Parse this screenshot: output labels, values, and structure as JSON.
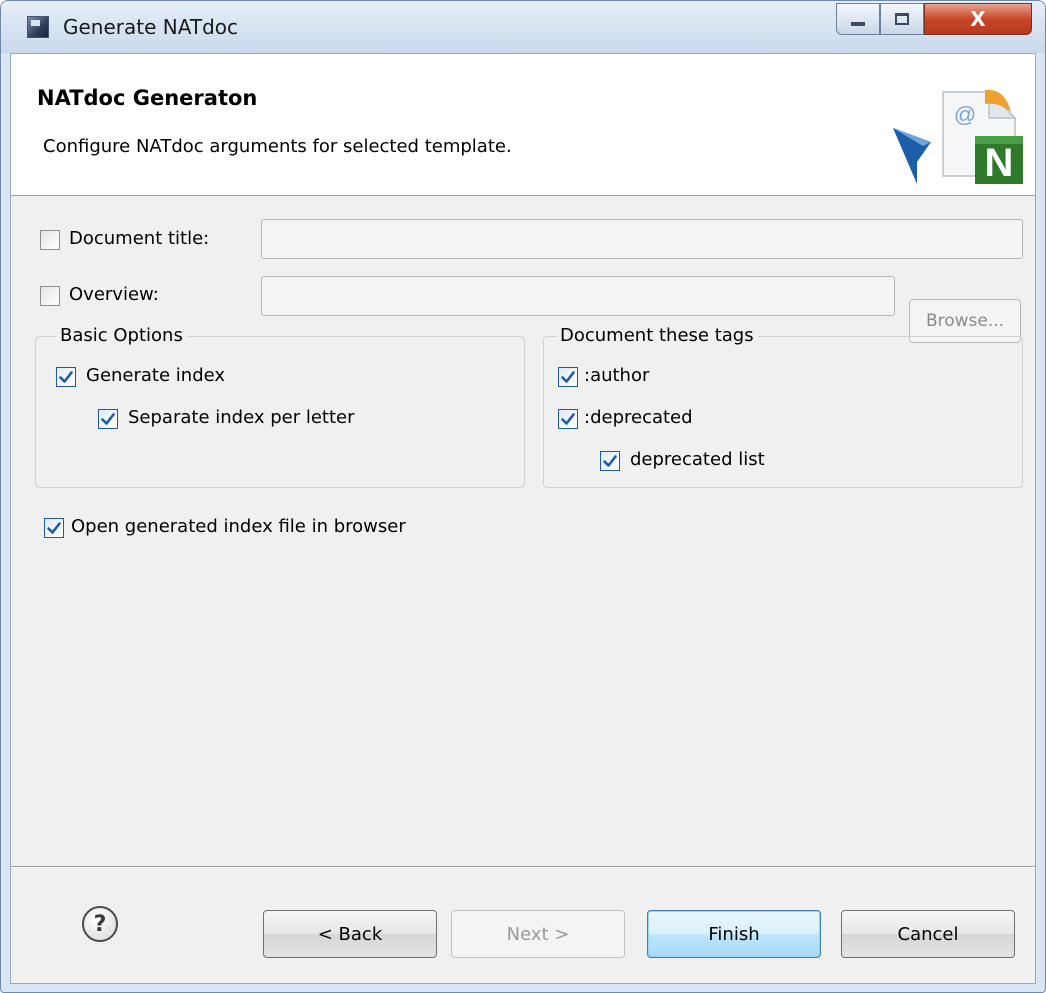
{
  "window": {
    "title": "Generate NATdoc",
    "close_glyph": "X"
  },
  "banner": {
    "title": "NATdoc Generaton",
    "description": "Configure NATdoc arguments for selected template.",
    "logo_letter": "N",
    "logo_at": "@"
  },
  "fields": {
    "document_title": {
      "label": "Document title:",
      "checked": false,
      "value": ""
    },
    "overview": {
      "label": "Overview:",
      "checked": false,
      "value": ""
    },
    "browse_label": "Browse..."
  },
  "basic_options": {
    "legend": "Basic Options",
    "generate_index": {
      "label": "Generate index",
      "checked": true
    },
    "separate_index": {
      "label": "Separate index per letter",
      "checked": true
    }
  },
  "tags": {
    "legend": "Document these tags",
    "author": {
      "label": ":author",
      "checked": true
    },
    "deprecated": {
      "label": ":deprecated",
      "checked": true
    },
    "deprecated_list": {
      "label": "deprecated list",
      "checked": true
    }
  },
  "open_in_browser": {
    "label": "Open generated index file in browser",
    "checked": true
  },
  "footer": {
    "help_glyph": "?",
    "back_label": "< Back",
    "next_label": "Next >",
    "finish_label": "Finish",
    "cancel_label": "Cancel"
  },
  "colors": {
    "check_mark": "#1e5aa8",
    "close_button": "#c8462a",
    "default_button_border": "#3c7fb1"
  }
}
